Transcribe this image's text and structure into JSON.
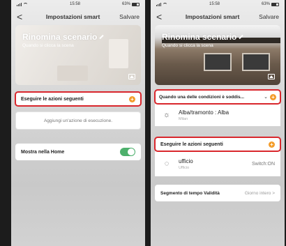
{
  "left": {
    "status": {
      "time": "15:58",
      "battery": "63%"
    },
    "nav": {
      "back": "<",
      "title": "Impostazioni smart",
      "save": "Salvare"
    },
    "banner": {
      "title": "Rinomina scenario",
      "subtitle": "Quando si clicca la scena"
    },
    "actions": {
      "label": "Eseguire le azioni seguenti",
      "plus": "+",
      "add_action": "Aggiungi un'azione di esecuzione."
    },
    "show_home": {
      "label": "Mostra nella Home"
    }
  },
  "right": {
    "status": {
      "time": "15:58",
      "battery": "63%"
    },
    "nav": {
      "back": "<",
      "title": "Impostazioni smart",
      "save": "Salvare"
    },
    "banner": {
      "title": "Rinomina scenario",
      "subtitle": "Quando si clicca la scena"
    },
    "condition": {
      "label": "Quando una delle condizioni è soddis...",
      "chevron": "⌄",
      "plus": "+"
    },
    "condition_item": {
      "title": "Alba/tramonto : Alba",
      "subtitle": "Milan"
    },
    "actions": {
      "label": "Eseguire le azioni seguenti",
      "plus": "+"
    },
    "action_item": {
      "title": "ufficio",
      "subtitle": "Ufficio",
      "status": "Switch:ON"
    },
    "validity": {
      "label": "Segmento di tempo Validità",
      "value": "Giorno intero >"
    }
  },
  "colors": {
    "accent": "#f39c2a",
    "highlight": "#d9262c",
    "toggle_on": "#4db06c"
  }
}
